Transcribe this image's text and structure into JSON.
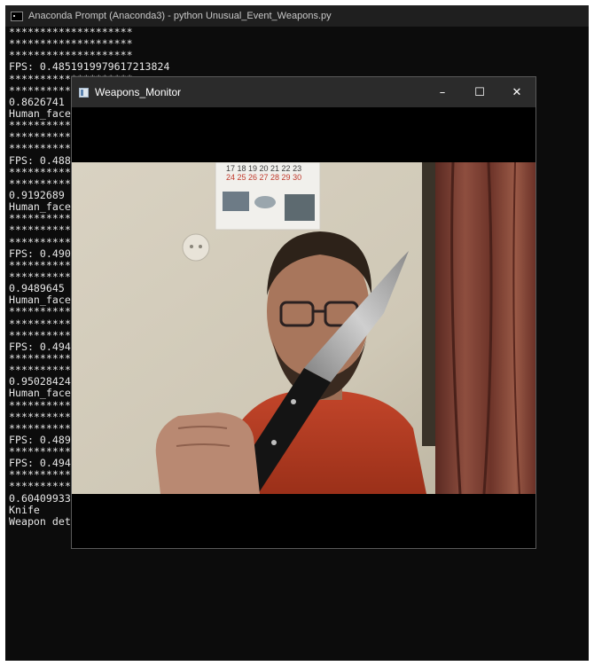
{
  "console": {
    "title": "Anaconda Prompt (Anaconda3) - python  Unusual_Event_Weapons.py",
    "lines": [
      "********************",
      "********************",
      "********************",
      "FPS: 0.4851919979617213824",
      "********************",
      "********************",
      "0.8626741",
      "Human_face",
      "********************",
      "********************",
      "********************",
      "FPS: 0.4885",
      "********************",
      "********************",
      "0.9192689",
      "Human_face",
      "********************",
      "********************",
      "********************",
      "FPS: 0.4909",
      "********************",
      "********************",
      "0.9489645",
      "Human_face",
      "********************",
      "********************",
      "********************",
      "FPS: 0.4947",
      "********************",
      "********************",
      "0.95028424",
      "Human_face",
      "********************",
      "********************",
      "********************",
      "FPS: 0.4896530008784541",
      "********************",
      "FPS: 0.4948468398402825",
      "********************",
      "********************",
      "0.60409933",
      "Knife",
      "Weapon detected"
    ]
  },
  "cv_window": {
    "title": "Weapons_Monitor",
    "minimize": "–",
    "maximize": "☐",
    "close": "✕",
    "calendar_numbers": [
      "17 18 19 20 21 22 23",
      "24 25 26 27 28 29 30"
    ]
  },
  "colors": {
    "console_bg": "#0c0c0c",
    "console_text": "#e6e6e6",
    "titlebar": "#1f1f1f",
    "cv_titlebar": "#2b2b2b"
  }
}
